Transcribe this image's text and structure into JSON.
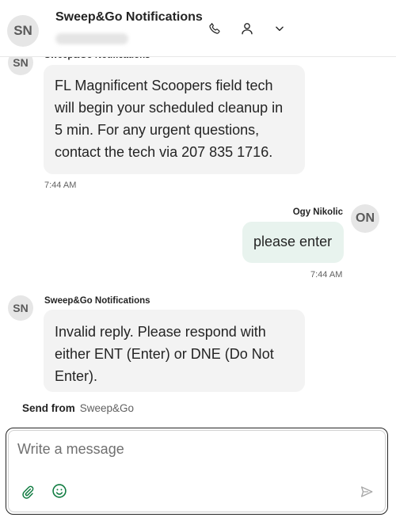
{
  "header": {
    "avatar_initials": "SN",
    "title": "Sweep&Go Notifications",
    "icons": [
      "phone-icon",
      "person-icon",
      "chevron-down-icon"
    ]
  },
  "messages": [
    {
      "direction": "in",
      "avatar": "SN",
      "sender": "Sweep&Go Notifications",
      "lines": [
        "FL Magnificent Scoopers field tech",
        "will begin your scheduled cleanup in",
        "5 min. For any urgent questions,",
        "contact the tech via 207 835 1716."
      ],
      "time": "7:44 AM"
    },
    {
      "direction": "out",
      "avatar": "ON",
      "sender": "Ogy Nikolic",
      "lines": [
        "please enter"
      ],
      "time": "7:44 AM"
    },
    {
      "direction": "in",
      "avatar": "SN",
      "sender": "Sweep&Go Notifications",
      "lines": [
        "Invalid reply. Please respond with",
        "either ENT (Enter) or DNE (Do Not",
        "Enter)."
      ],
      "time": ""
    }
  ],
  "send_from": {
    "label": "Send from",
    "value": "Sweep&Go"
  },
  "composer": {
    "placeholder": "Write a message",
    "icons": [
      "paperclip-icon",
      "emoji-icon",
      "send-icon"
    ]
  },
  "colors": {
    "incoming_bubble": "#f3f3f3",
    "outgoing_bubble": "#e8f3ee",
    "avatar_bg": "#e6e6e6",
    "icon_green": "#107c41"
  }
}
